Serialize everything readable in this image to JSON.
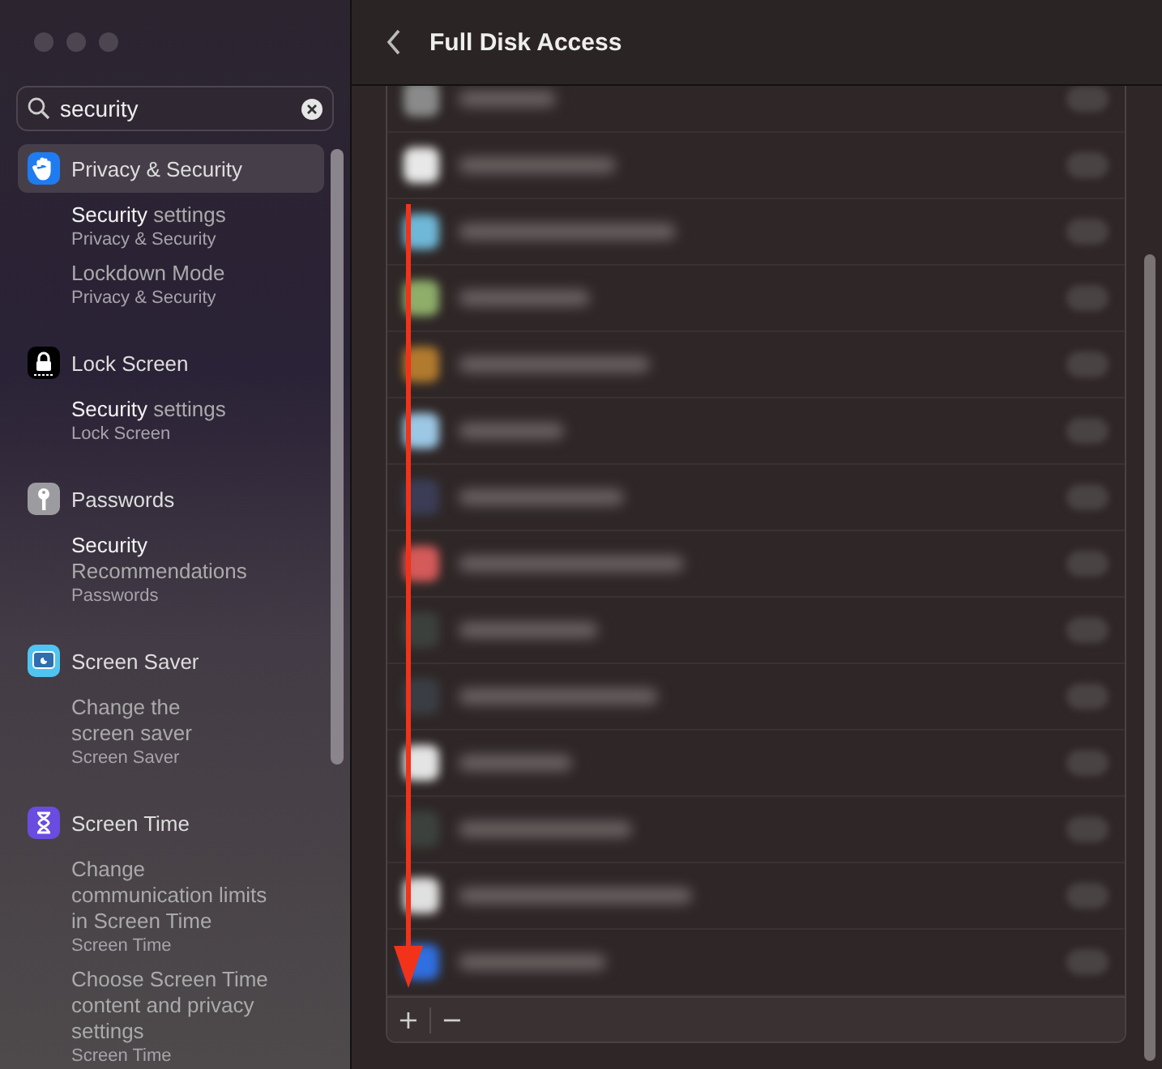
{
  "search": {
    "value": "security"
  },
  "sidebar": {
    "groups": [
      {
        "label": "Privacy & Security",
        "selected": true,
        "results": [
          {
            "title": "**Security** settings",
            "subtitle": "Privacy & Security"
          },
          {
            "title": "Lockdown Mode",
            "subtitle": "Privacy & Security"
          }
        ]
      },
      {
        "label": "Lock Screen",
        "selected": false,
        "results": [
          {
            "title": "**Security** settings",
            "subtitle": "Lock Screen"
          }
        ]
      },
      {
        "label": "Passwords",
        "selected": false,
        "results": [
          {
            "title": "**Security**\nRecommendations",
            "subtitle": "Passwords"
          }
        ]
      },
      {
        "label": "Screen Saver",
        "selected": false,
        "results": [
          {
            "title": "Change the\nscreen saver",
            "subtitle": "Screen Saver"
          }
        ]
      },
      {
        "label": "Screen Time",
        "selected": false,
        "results": [
          {
            "title": "Change\ncommunication limits\nin Screen Time",
            "subtitle": "Screen Time"
          },
          {
            "title": "Choose Screen Time\ncontent and privacy\nsettings",
            "subtitle": "Screen Time"
          }
        ]
      }
    ]
  },
  "header": {
    "title": "Full Disk Access"
  },
  "apps": [
    {
      "color": "#8a8a8a",
      "on": false
    },
    {
      "color": "#e8e8e8",
      "on": false
    },
    {
      "color": "#6fb8d8",
      "on": false
    },
    {
      "color": "#8fae6a",
      "on": false
    },
    {
      "color": "#b27a2e",
      "on": false
    },
    {
      "color": "#9cc8e6",
      "on": false
    },
    {
      "color": "#3a3d55",
      "on": false
    },
    {
      "color": "#d55a5a",
      "on": false
    },
    {
      "color": "#3c403c",
      "on": false
    },
    {
      "color": "#3a3e44",
      "on": false
    },
    {
      "color": "#e4e4e4",
      "on": false
    },
    {
      "color": "#3b423d",
      "on": false
    },
    {
      "color": "#e0e0e0",
      "on": false
    },
    {
      "color": "#2f6fe0",
      "on": false
    }
  ],
  "footer": {
    "add": "+",
    "remove": "−"
  }
}
